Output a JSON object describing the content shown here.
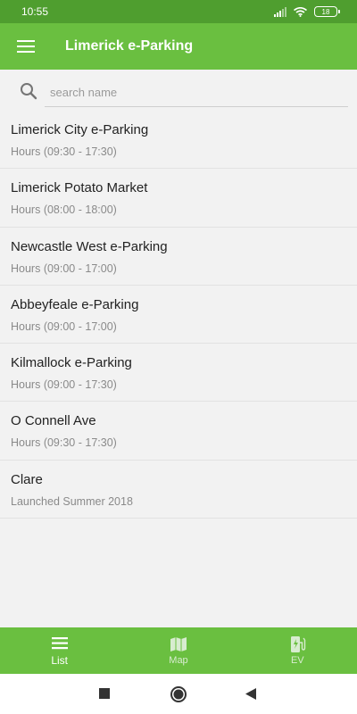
{
  "status_bar": {
    "time": "10:55",
    "battery": "18"
  },
  "app_bar": {
    "title": "Limerick e-Parking",
    "menu_icon": "hamburger-menu-icon"
  },
  "search": {
    "placeholder": "search name",
    "value": ""
  },
  "locations": [
    {
      "name": "Limerick City e-Parking",
      "hours": "Hours (09:30 - 17:30)"
    },
    {
      "name": "Limerick Potato Market",
      "hours": "Hours (08:00 - 18:00)"
    },
    {
      "name": "Newcastle West e-Parking",
      "hours": "Hours (09:00 - 17:00)"
    },
    {
      "name": "Abbeyfeale e-Parking",
      "hours": "Hours (09:00 - 17:00)"
    },
    {
      "name": "Kilmallock e-Parking",
      "hours": "Hours (09:00 - 17:30)"
    },
    {
      "name": "O Connell Ave",
      "hours": "Hours (09:30 - 17:30)"
    },
    {
      "name": "Clare",
      "hours": "Launched Summer 2018"
    }
  ],
  "bottom_nav": [
    {
      "label": "List",
      "icon": "list-icon",
      "active": true
    },
    {
      "label": "Map",
      "icon": "map-icon",
      "active": false
    },
    {
      "label": "EV",
      "icon": "ev-charger-icon",
      "active": false
    }
  ],
  "colors": {
    "status_bar": "#4f9e2f",
    "primary": "#6abf40",
    "background": "#f2f2f2"
  }
}
